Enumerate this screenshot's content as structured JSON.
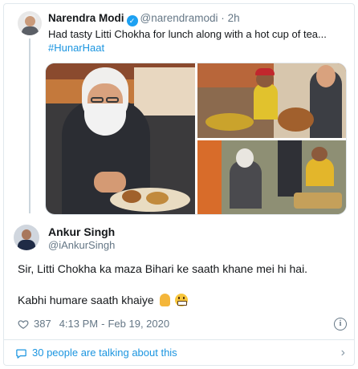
{
  "parent_tweet": {
    "author_name": "Narendra Modi",
    "verified_mark": "✓",
    "handle": "@narendramodi",
    "separator": "·",
    "time": "2h",
    "text": "Had tasty Litti Chokha for lunch along with a hot cup of tea...",
    "hashtag": "#HunarHaat",
    "media": [
      "photo-eating-litti",
      "photo-food-stall",
      "photo-seated-with-vendors"
    ]
  },
  "reply": {
    "author_name": "Ankur Singh",
    "handle": "@iAnkurSingh",
    "line1": "Sir, Litti Chokha ka maza Bihari ke saath khane mei hi hai.",
    "line2": "Kabhi humare saath khaiye",
    "emojis": [
      "folded-hands-emoji",
      "grinning-face-emoji"
    ],
    "like_count": "387",
    "time": "4:13 PM",
    "date_separator": "-",
    "date": "Feb 19, 2020",
    "info_glyph": "i"
  },
  "conversation": {
    "label": "30 people are talking about this",
    "chevron": "›"
  },
  "colors": {
    "link": "#1b95e0",
    "secondary_text": "#657786",
    "border": "#e1e8ed",
    "verified": "#1da1f2"
  }
}
